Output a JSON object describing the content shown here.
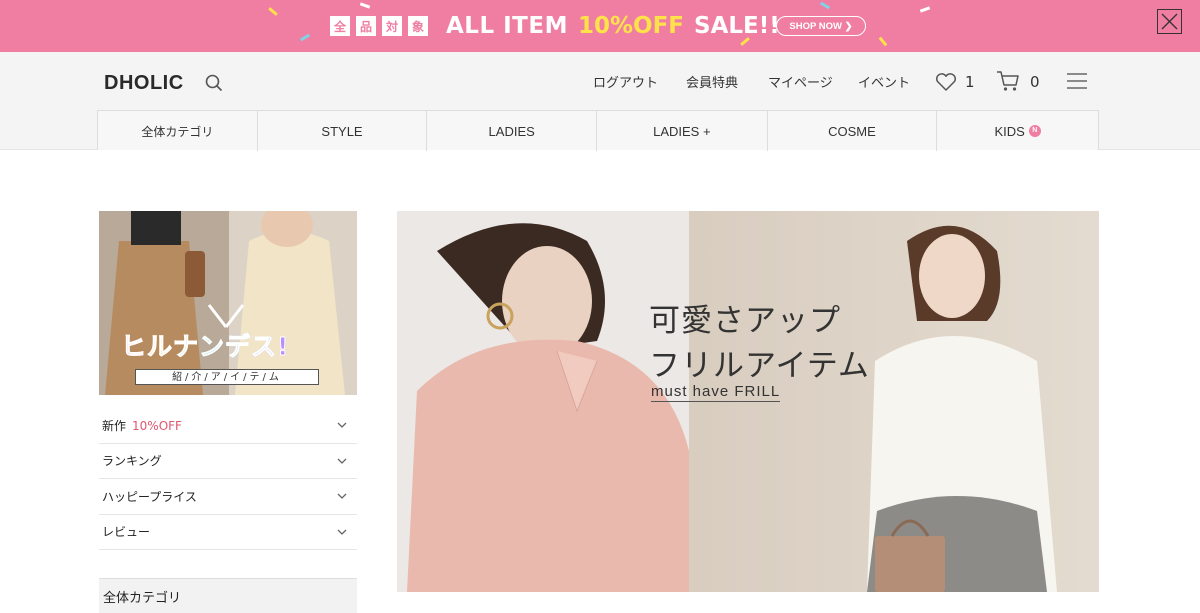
{
  "promo": {
    "kanji": [
      "全",
      "品",
      "対",
      "象"
    ],
    "main": "ALL ITEM",
    "highlight": "10%OFF",
    "sale": "SALE!!",
    "shop_now": "SHOP NOW ❯",
    "bg_color": "#f07ea3",
    "highlight_color": "#ffe14a"
  },
  "header": {
    "logo": "DHOLIC",
    "nav": {
      "logout": "ログアウト",
      "member": "会員特典",
      "mypage": "マイページ",
      "event": "イベント"
    },
    "wishlist_count": "1",
    "cart_count": "0"
  },
  "categories": [
    {
      "label": "全体カテゴリ"
    },
    {
      "label": "STYLE"
    },
    {
      "label": "LADIES"
    },
    {
      "label": "LADIES +"
    },
    {
      "label": "COSME"
    },
    {
      "label": "KIDS"
    }
  ],
  "kids_badge": "N",
  "sidebar": {
    "promo_title": "ヒルナンデス!",
    "promo_sub": "紹/介/ア/イ/テ/ム",
    "menu": [
      {
        "label": "新作",
        "extra": "10%OFF"
      },
      {
        "label": "ランキング",
        "extra": ""
      },
      {
        "label": "ハッピープライス",
        "extra": ""
      },
      {
        "label": "レビュー",
        "extra": ""
      }
    ],
    "all_category": "全体カテゴリ"
  },
  "hero": {
    "line1": "可愛さアップ",
    "line2": "フリルアイテム",
    "sub": "must have FRILL"
  }
}
